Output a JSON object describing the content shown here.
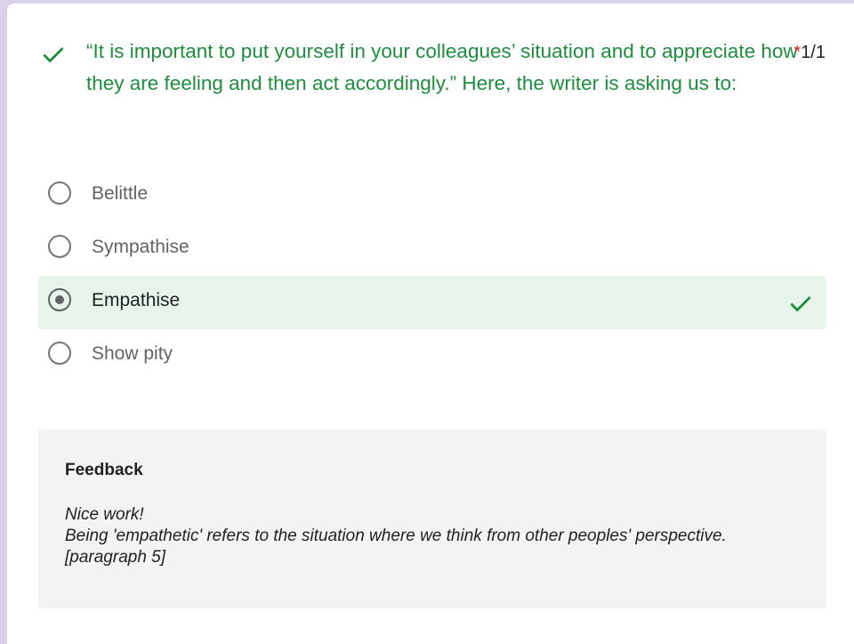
{
  "question": {
    "text": "“It is important to put yourself in your colleagues’ situation and to appreciate how they are feeling and then act accordingly.” Here, the writer is asking us to:",
    "required_marker": "*",
    "score": "1/1",
    "status_icon": "checkmark-icon",
    "status": "correct"
  },
  "options": [
    {
      "label": "Belittle",
      "selected": false,
      "correct": false
    },
    {
      "label": "Sympathise",
      "selected": false,
      "correct": false
    },
    {
      "label": "Empathise",
      "selected": true,
      "correct": true
    },
    {
      "label": "Show pity",
      "selected": false,
      "correct": false
    }
  ],
  "feedback": {
    "title": "Feedback",
    "lines": [
      "Nice work!",
      "Being 'empathetic' refers to the situation where we think from other peoples' perspective.",
      "[paragraph 5]"
    ]
  },
  "colors": {
    "correct_text": "#1e8e3e",
    "correct_bg": "#e6f4ea",
    "required": "#d93025",
    "accent_bg": "#d9d2ea",
    "feedback_bg": "#f3f3f3"
  }
}
